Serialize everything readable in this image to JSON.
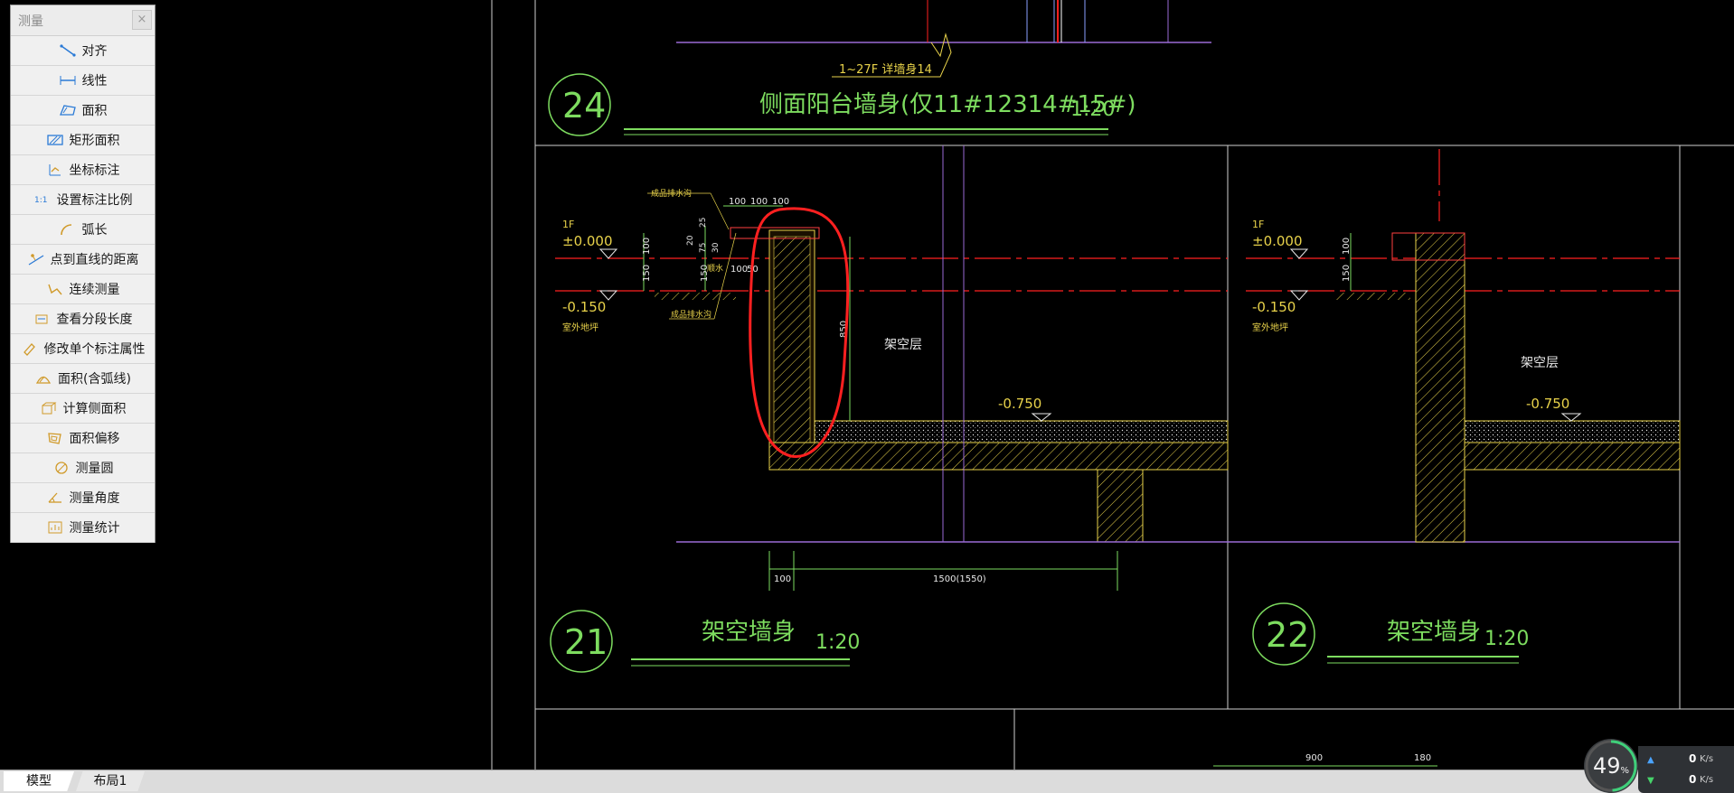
{
  "measure_panel": {
    "title": "测量",
    "close_label": "×",
    "tools": [
      {
        "label": "对齐",
        "icon": "aligned-dimension-icon"
      },
      {
        "label": "线性",
        "icon": "linear-dimension-icon"
      },
      {
        "label": "面积",
        "icon": "area-icon"
      },
      {
        "label": "矩形面积",
        "icon": "rectangle-area-icon"
      },
      {
        "label": "坐标标注",
        "icon": "coordinate-label-icon"
      },
      {
        "label": "设置标注比例",
        "icon": "scale-setting-icon"
      },
      {
        "label": "弧长",
        "icon": "arc-length-icon"
      },
      {
        "label": "点到直线的距离",
        "icon": "point-line-distance-icon"
      },
      {
        "label": "连续测量",
        "icon": "continuous-measure-icon"
      },
      {
        "label": "查看分段长度",
        "icon": "segment-length-icon"
      },
      {
        "label": "修改单个标注属性",
        "icon": "edit-annotation-icon"
      },
      {
        "label": "面积(含弧线)",
        "icon": "arc-area-icon"
      },
      {
        "label": "计算侧面积",
        "icon": "side-area-icon"
      },
      {
        "label": "面积偏移",
        "icon": "area-offset-icon"
      },
      {
        "label": "测量圆",
        "icon": "measure-circle-icon"
      },
      {
        "label": "测量角度",
        "icon": "measure-angle-icon"
      },
      {
        "label": "测量统计",
        "icon": "measure-stats-icon"
      }
    ]
  },
  "drawing": {
    "detail_24": {
      "number": "24",
      "title": "侧面阳台墙身(仅11#12314#15#)",
      "scale": "1:20",
      "note": "1~27F 详墙身14"
    },
    "detail_21": {
      "number": "21",
      "title": "架空墙身",
      "scale": "1:20"
    },
    "detail_22": {
      "number": "22",
      "title": "架空墙身",
      "scale": "1:20"
    },
    "left_section": {
      "floor": "1F",
      "level_0": "±0.000",
      "level_neg": "-0.150",
      "outdoor": "室外地坪",
      "level_space": "-0.750",
      "space_label": "架空层",
      "dims_top": [
        "100",
        "100",
        "100"
      ],
      "dims_side": [
        "100",
        "150",
        "150",
        "20",
        "75",
        "30",
        "25",
        "100",
        "50"
      ],
      "dim_wall": "850",
      "dim_bottom_1": "100",
      "dim_bottom_2": "1500(1550)",
      "notes": [
        "成品排水沟",
        "顺水",
        "成品排水沟"
      ]
    },
    "right_section": {
      "floor": "1F",
      "level_0": "±0.000",
      "level_neg": "-0.150",
      "outdoor": "室外地坪",
      "level_space": "-0.750",
      "space_label": "架空层",
      "dims_side": [
        "100",
        "150"
      ]
    },
    "bottom_dims": [
      "900",
      "180"
    ]
  },
  "tabs": {
    "model": "模型",
    "layout": "布局1"
  },
  "network": {
    "percent": "49",
    "percent_unit": "%",
    "up_value": "0",
    "down_value": "0",
    "unit": "K/s",
    "up_arrow": "▲",
    "down_arrow": "▼"
  },
  "colors": {
    "background": "#000000",
    "green": "#7ddc5f",
    "yellow": "#e8d24a",
    "red": "#ff2020",
    "purple": "#9a6ad6",
    "white": "#e8e8e8"
  }
}
